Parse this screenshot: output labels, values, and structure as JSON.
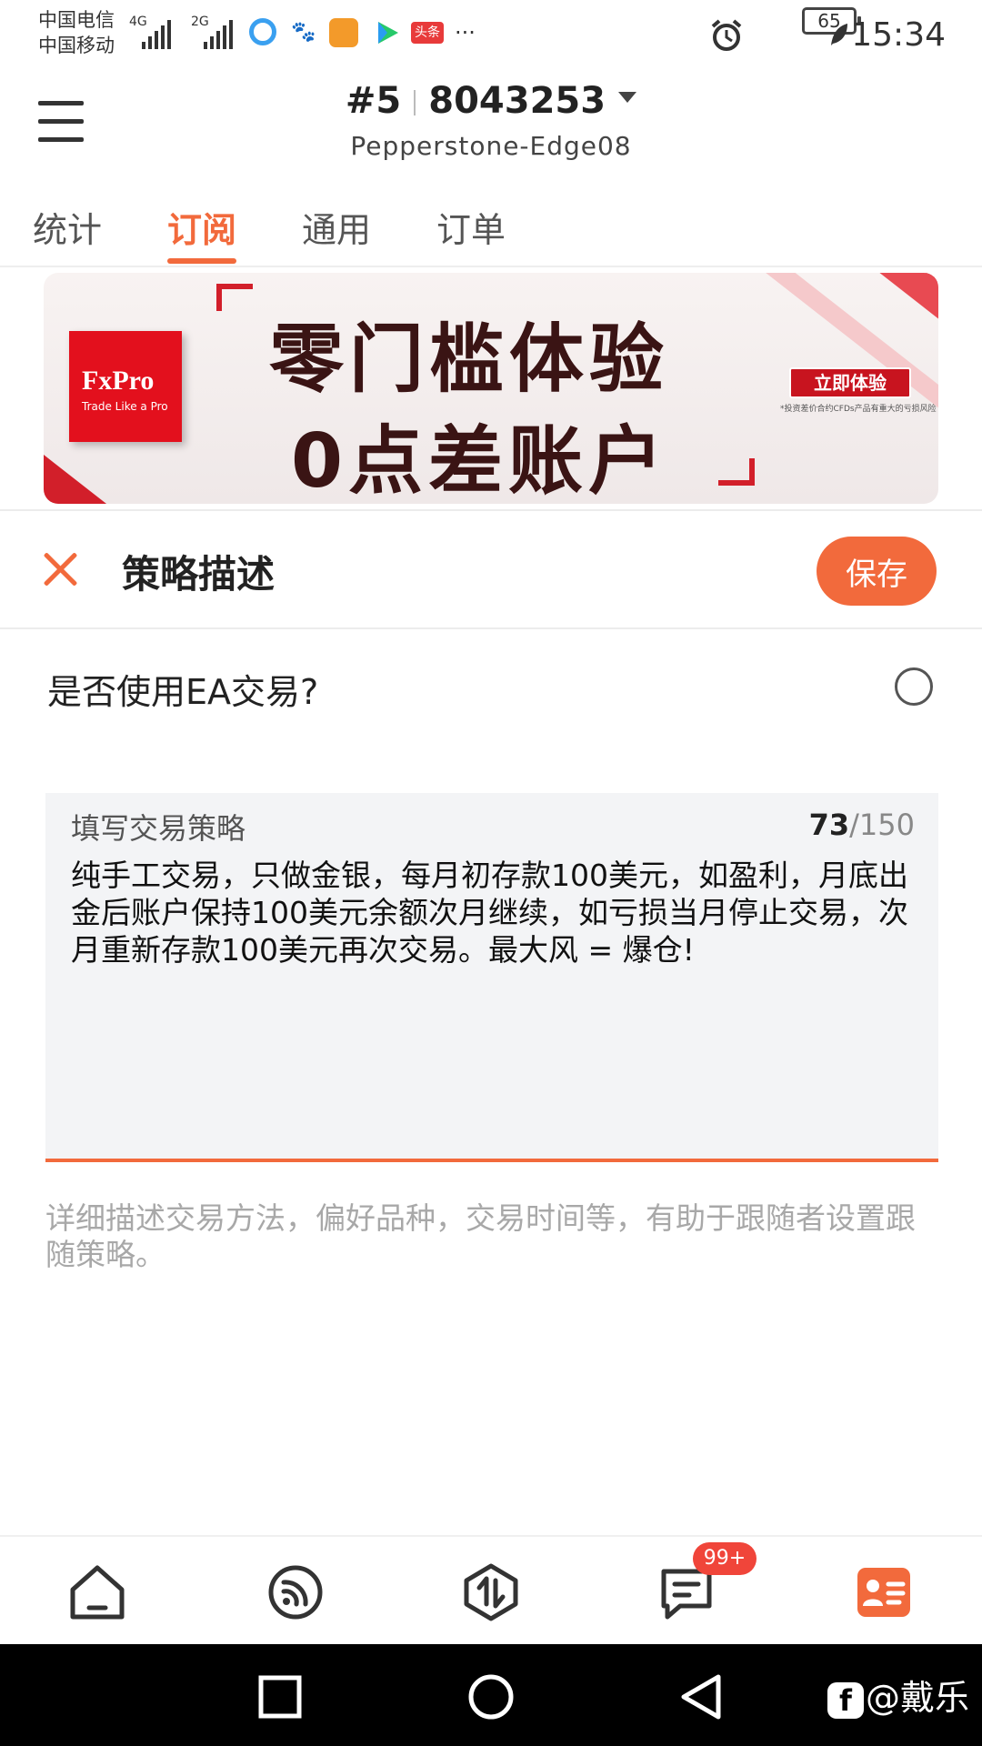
{
  "status_bar": {
    "carrier_1": "中国电信",
    "carrier_2": "中国移动",
    "network_1": "4G",
    "network_2": "2G",
    "battery": "65",
    "time": "15:34",
    "more": "···"
  },
  "header": {
    "account_index": "#5",
    "account_number": "8043253",
    "server": "Pepperstone-Edge08"
  },
  "tabs": [
    {
      "label": "统计",
      "active": false
    },
    {
      "label": "订阅",
      "active": true
    },
    {
      "label": "通用",
      "active": false
    },
    {
      "label": "订单",
      "active": false
    }
  ],
  "banner": {
    "brand": "FxPro",
    "brand_tagline": "Trade Like a Pro",
    "line1": "零门槛体验",
    "line2": "0点差账户",
    "cta": "立即体验",
    "note": "*投资差价合约CFDs产品有重大的亏损风险"
  },
  "section": {
    "title": "策略描述",
    "save_label": "保存"
  },
  "ea_question": {
    "label": "是否使用EA交易?",
    "checked": false
  },
  "strategy": {
    "label": "填写交易策略",
    "count": "73",
    "max": "/150",
    "text": "纯手工交易，只做金银，每月初存款100美元，如盈利，月底出金后账户保持100美元余额次月继续，如亏损当月停止交易，次月重新存款100美元再次交易。最大风 = 爆仓!"
  },
  "hint": "详细描述交易方法，偏好品种，交易时间等，有助于跟随者设置跟随策略。",
  "bottom_nav": {
    "items": [
      "home-icon",
      "signal-icon",
      "trade-icon",
      "message-icon",
      "profile-icon"
    ],
    "message_badge": "99+"
  },
  "watermark": "@戴乐",
  "colors": {
    "accent": "#f26a3c",
    "badge": "#f0453a",
    "banner_red": "#d21f2a"
  }
}
